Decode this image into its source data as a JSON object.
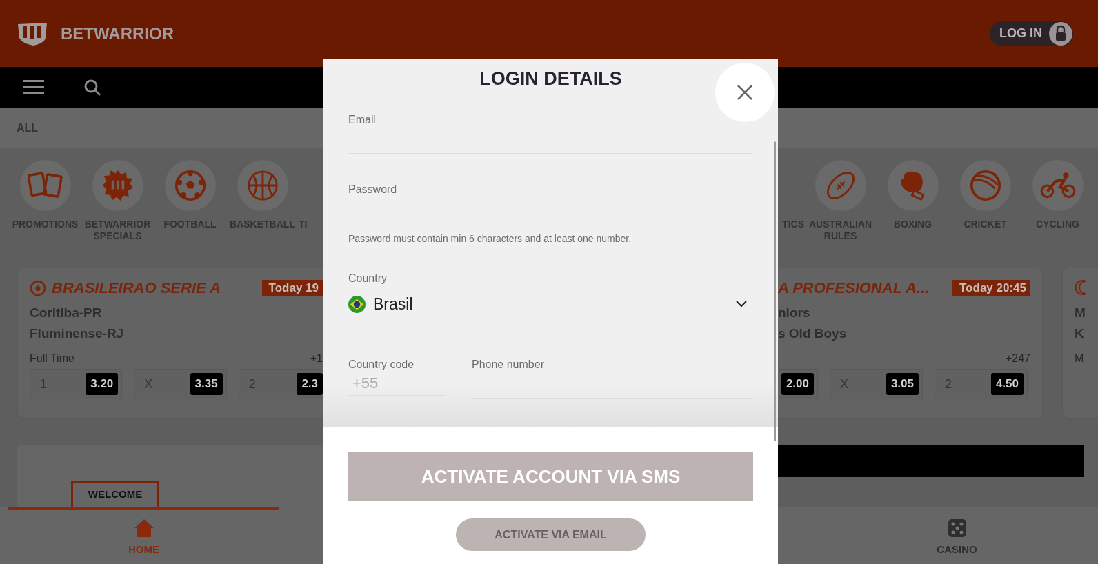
{
  "header": {
    "brand": "BETWARRIOR",
    "login": "LOG IN"
  },
  "filter": {
    "label": "ALL"
  },
  "sports_left": [
    "PROMOTIONS",
    "BETWARRIOR SPECIALS",
    "FOOTBALL",
    "BASKETBALL",
    "TI"
  ],
  "sports_right": [
    "TICS",
    "AUSTRALIAN RULES",
    "BOXING",
    "CRICKET",
    "CYCLING"
  ],
  "card_left": {
    "league": "BRASILEIRAO SERIE A",
    "time": "Today 19",
    "teams": [
      "Coritiba-PR",
      "Fluminense-RJ"
    ],
    "market": "Full Time",
    "more": "+1",
    "odds": [
      {
        "label": "1",
        "price": "3.20"
      },
      {
        "label": "X",
        "price": "3.35"
      },
      {
        "label": "2",
        "price": "2.3"
      }
    ]
  },
  "card_right": {
    "league": "A PROFESIONAL A...",
    "time": "Today 20:45",
    "teams": [
      "niors",
      "s Old Boys"
    ],
    "more": "+247",
    "odds": [
      {
        "price": "2.00"
      },
      {
        "label": "X",
        "price": "3.05"
      },
      {
        "label": "2",
        "price": "4.50"
      }
    ]
  },
  "card_far_right": {
    "teams": [
      "M",
      "K"
    ],
    "market": "M"
  },
  "banner": {
    "offer": "WELCOME"
  },
  "bottom_nav": [
    {
      "label": "HOME",
      "selected": true
    },
    {
      "label": "CASINO",
      "selected": false
    }
  ],
  "modal": {
    "title": "LOGIN DETAILS",
    "email_label": "Email",
    "password_label": "Password",
    "password_hint": "Password must contain min 6 characters and at least one number.",
    "country_label": "Country",
    "country": "Brasil",
    "country_code_label": "Country code",
    "country_code": "+55",
    "phone_label": "Phone number",
    "sms_button": {
      "label": "ACTIVATE ACCOUNT VIA SMS",
      "disabled": true
    },
    "email_button": {
      "label": "ACTIVATE VIA EMAIL",
      "disabled": true
    }
  }
}
